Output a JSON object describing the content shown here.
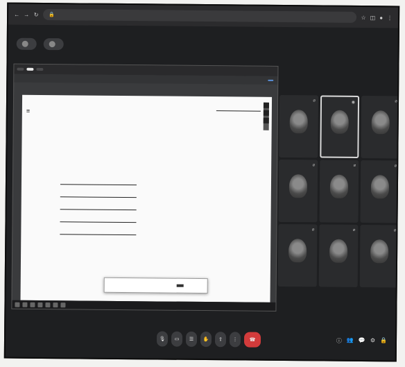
{
  "browser": {
    "url_host": "",
    "url_path": ""
  },
  "meet_header": {
    "badge_1": "",
    "badge_2": ""
  },
  "share": {
    "tabs": [
      "",
      "",
      ""
    ],
    "url": "",
    "share_button": ""
  },
  "doc": {
    "section_labels": [
      "",
      "",
      ""
    ],
    "field_labels": [
      "",
      "",
      "",
      "",
      ""
    ],
    "field_values": [
      "",
      "",
      "",
      "",
      ""
    ],
    "right_heading_1": "",
    "right_highlight_1": "",
    "right_heading_2": "",
    "dialog_label": "",
    "dialog_button": ""
  },
  "participants": [
    {
      "name": ""
    },
    {
      "name": ""
    },
    {
      "name": ""
    },
    {
      "name": ""
    },
    {
      "name": ""
    },
    {
      "name": ""
    },
    {
      "name": ""
    },
    {
      "name": ""
    },
    {
      "name": ""
    }
  ],
  "bottom": {
    "time": "",
    "meeting_title": ""
  },
  "colors": {
    "background": "#1e1f21",
    "end_call": "#d23b3b",
    "tile": "#2a2b2d"
  }
}
